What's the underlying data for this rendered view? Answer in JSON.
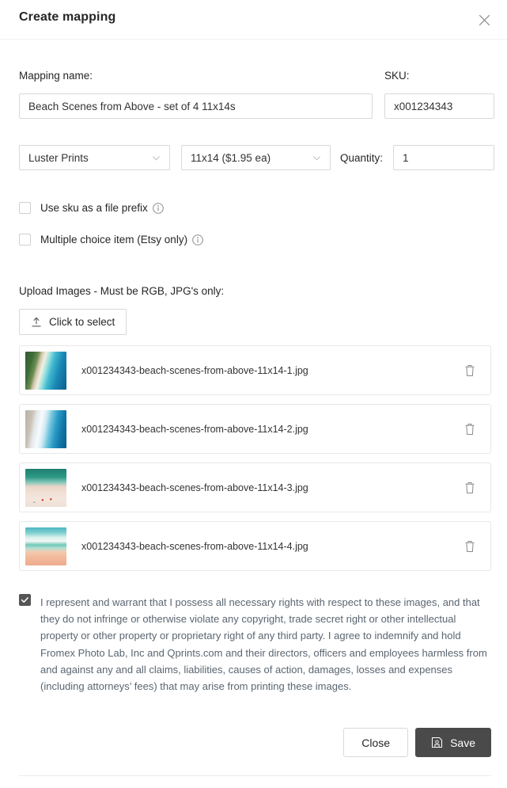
{
  "header": {
    "title": "Create mapping",
    "close_icon": "close-icon"
  },
  "form": {
    "mapping_name_label": "Mapping name:",
    "mapping_name_value": "Beach Scenes from Above - set of 4 11x14s",
    "sku_label": "SKU:",
    "sku_value": "x001234343",
    "product_type_value": "Luster Prints",
    "size_value": "11x14 ($1.95 ea)",
    "quantity_label": "Quantity:",
    "quantity_value": "1"
  },
  "options": [
    {
      "label": "Use sku as a file prefix",
      "checked": false,
      "info_icon": "info-icon"
    },
    {
      "label": "Multiple choice item (Etsy only)",
      "checked": false,
      "info_icon": "info-icon"
    }
  ],
  "upload": {
    "label": "Upload Images - Must be RGB, JPG's only:",
    "button_label": "Click to select",
    "button_icon": "upload-icon"
  },
  "files": [
    {
      "name": "x001234343-beach-scenes-from-above-11x14-1.jpg",
      "delete_icon": "trash-icon"
    },
    {
      "name": "x001234343-beach-scenes-from-above-11x14-2.jpg",
      "delete_icon": "trash-icon"
    },
    {
      "name": "x001234343-beach-scenes-from-above-11x14-3.jpg",
      "delete_icon": "trash-icon"
    },
    {
      "name": "x001234343-beach-scenes-from-above-11x14-4.jpg",
      "delete_icon": "trash-icon"
    }
  ],
  "consent": {
    "checked": true,
    "text": "I represent and warrant that I possess all necessary rights with respect to these images, and that they do not infringe or otherwise violate any copyright, trade secret right or other intellectual property or other property or proprietary right of any third party. I agree to indemnify and hold Fromex Photo Lab, Inc and Qprints.com and their directors, officers and employees harmless from and against any and all claims, liabilities, causes of action, damages, losses and expenses (including attorneys’ fees) that may arise from printing these images."
  },
  "footer": {
    "close_label": "Close",
    "save_label": "Save",
    "save_icon": "save-disk-icon"
  },
  "colors": {
    "save_button_bg": "#4a4a4a",
    "checkbox_checked_bg": "#555555",
    "border": "#d9d9d9",
    "text": "#262626",
    "consent_text": "#5a6570"
  }
}
